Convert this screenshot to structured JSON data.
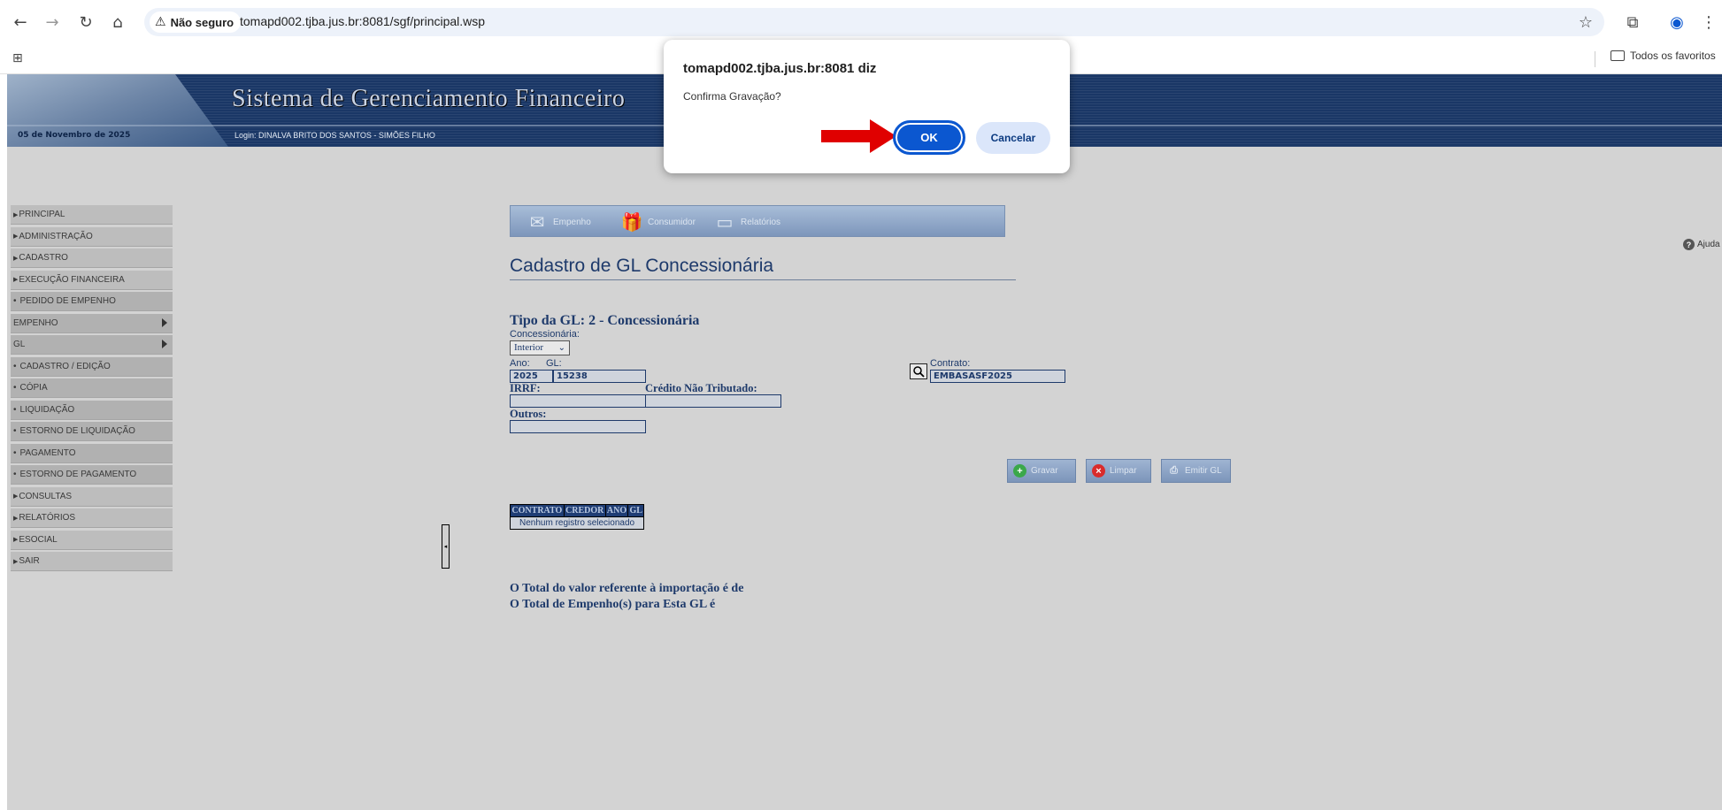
{
  "browser": {
    "security_label": "Não seguro",
    "url": "tomapd002.tjba.jus.br:8081/sgf/principal.wsp",
    "bookmarks_folder": "Todos os favoritos"
  },
  "header": {
    "title": "Sistema de Gerenciamento Financeiro",
    "date": "05 de Novembro de 2025",
    "login": "Login: DINALVA BRITO DOS SANTOS - SIMÕES FILHO"
  },
  "menu": {
    "items": [
      "PRINCIPAL",
      "ADMINISTRAÇÃO",
      "CADASTRO",
      "EXECUÇÃO FINANCEIRA",
      "PEDIDO DE EMPENHO",
      "EMPENHO",
      "GL",
      "CADASTRO / EDIÇÃO",
      "CÓPIA",
      "LIQUIDAÇÃO",
      "ESTORNO DE LIQUIDAÇÃO",
      "PAGAMENTO",
      "ESTORNO DE PAGAMENTO",
      "CONSULTAS",
      "RELATÓRIOS",
      "ESOCIAL",
      "SAIR"
    ]
  },
  "modules": {
    "empenho": "Empenho",
    "consumidor": "Consumidor",
    "relatorios": "Relatórios"
  },
  "help": "Ajuda",
  "form": {
    "title": "Cadastro de GL Concessionária",
    "gl_type": "Tipo da GL: 2 - Concessionária",
    "concessionaria_label": "Concessionária:",
    "concessionaria_value": "Interior",
    "ano_label": "Ano:",
    "gl_label": "GL:",
    "ano_value": "2025",
    "gl_value": "15238",
    "contrato_label": "Contrato:",
    "contrato_value": "EMBASASF2025",
    "irrf_label": "IRRF:",
    "credito_label": "Crédito Não Tributado:",
    "outros_label": "Outros:"
  },
  "actions": {
    "gravar": "Gravar",
    "limpar": "Limpar",
    "emitir": "Emitir GL"
  },
  "table": {
    "headers": [
      "CONTRATO",
      "CREDOR",
      "ANO",
      "GL"
    ],
    "empty_message": "Nenhum registro selecionado"
  },
  "totals": {
    "line1": "O Total do valor referente à importação é de",
    "line2": "O Total de Empenho(s) para Esta GL é"
  },
  "dialog": {
    "title": "tomapd002.tjba.jus.br:8081 diz",
    "message": "Confirma Gravação?",
    "ok_label": "OK",
    "cancel_label": "Cancelar"
  }
}
